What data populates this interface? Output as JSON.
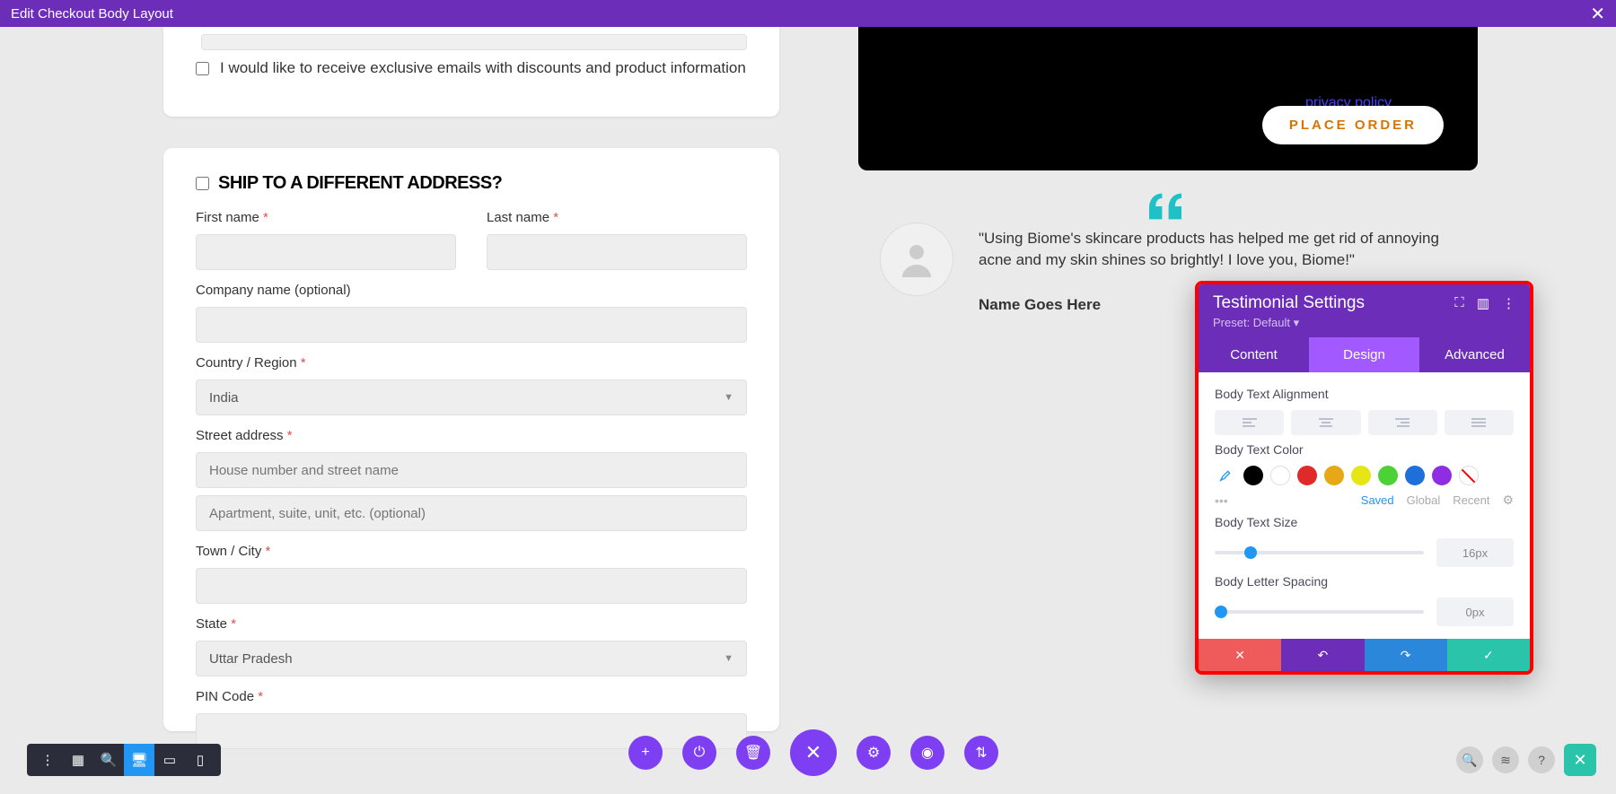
{
  "topbar": {
    "title": "Edit Checkout Body Layout"
  },
  "card1": {
    "checkbox_label": "I would like to receive exclusive emails with discounts and product information"
  },
  "form": {
    "ship_heading": "Ship to a different address?",
    "first_name": "First name",
    "last_name": "Last name",
    "company": "Company name (optional)",
    "country": "Country / Region",
    "country_value": "India",
    "street": "Street address",
    "street_ph1": "House number and street name",
    "street_ph2": "Apartment, suite, unit, etc. (optional)",
    "town": "Town / City",
    "state": "State",
    "state_value": "Uttar Pradesh",
    "pincode": "PIN Code",
    "req": "*"
  },
  "order": {
    "privacy": "privacy policy",
    "place_order": "PLACE ORDER"
  },
  "testimonial": {
    "quote": "\"Using Biome's skincare products has helped me get rid of annoying acne and my skin shines so brightly! I love you, Biome!\"",
    "name": "Name Goes Here"
  },
  "panel": {
    "title": "Testimonial Settings",
    "preset": "Preset: Default ▾",
    "tabs": {
      "content": "Content",
      "design": "Design",
      "advanced": "Advanced"
    },
    "labels": {
      "alignment": "Body Text Alignment",
      "color": "Body Text Color",
      "size": "Body Text Size",
      "spacing": "Body Letter Spacing"
    },
    "colors": [
      "#000000",
      "#ffffff",
      "#e02a2a",
      "#e6a817",
      "#e6e617",
      "#4cd137",
      "#1e6fd9",
      "#8e2de2"
    ],
    "color_tabs": {
      "saved": "Saved",
      "global": "Global",
      "recent": "Recent"
    },
    "size_value": "16px",
    "spacing_value": "0px",
    "dots": "•••"
  }
}
